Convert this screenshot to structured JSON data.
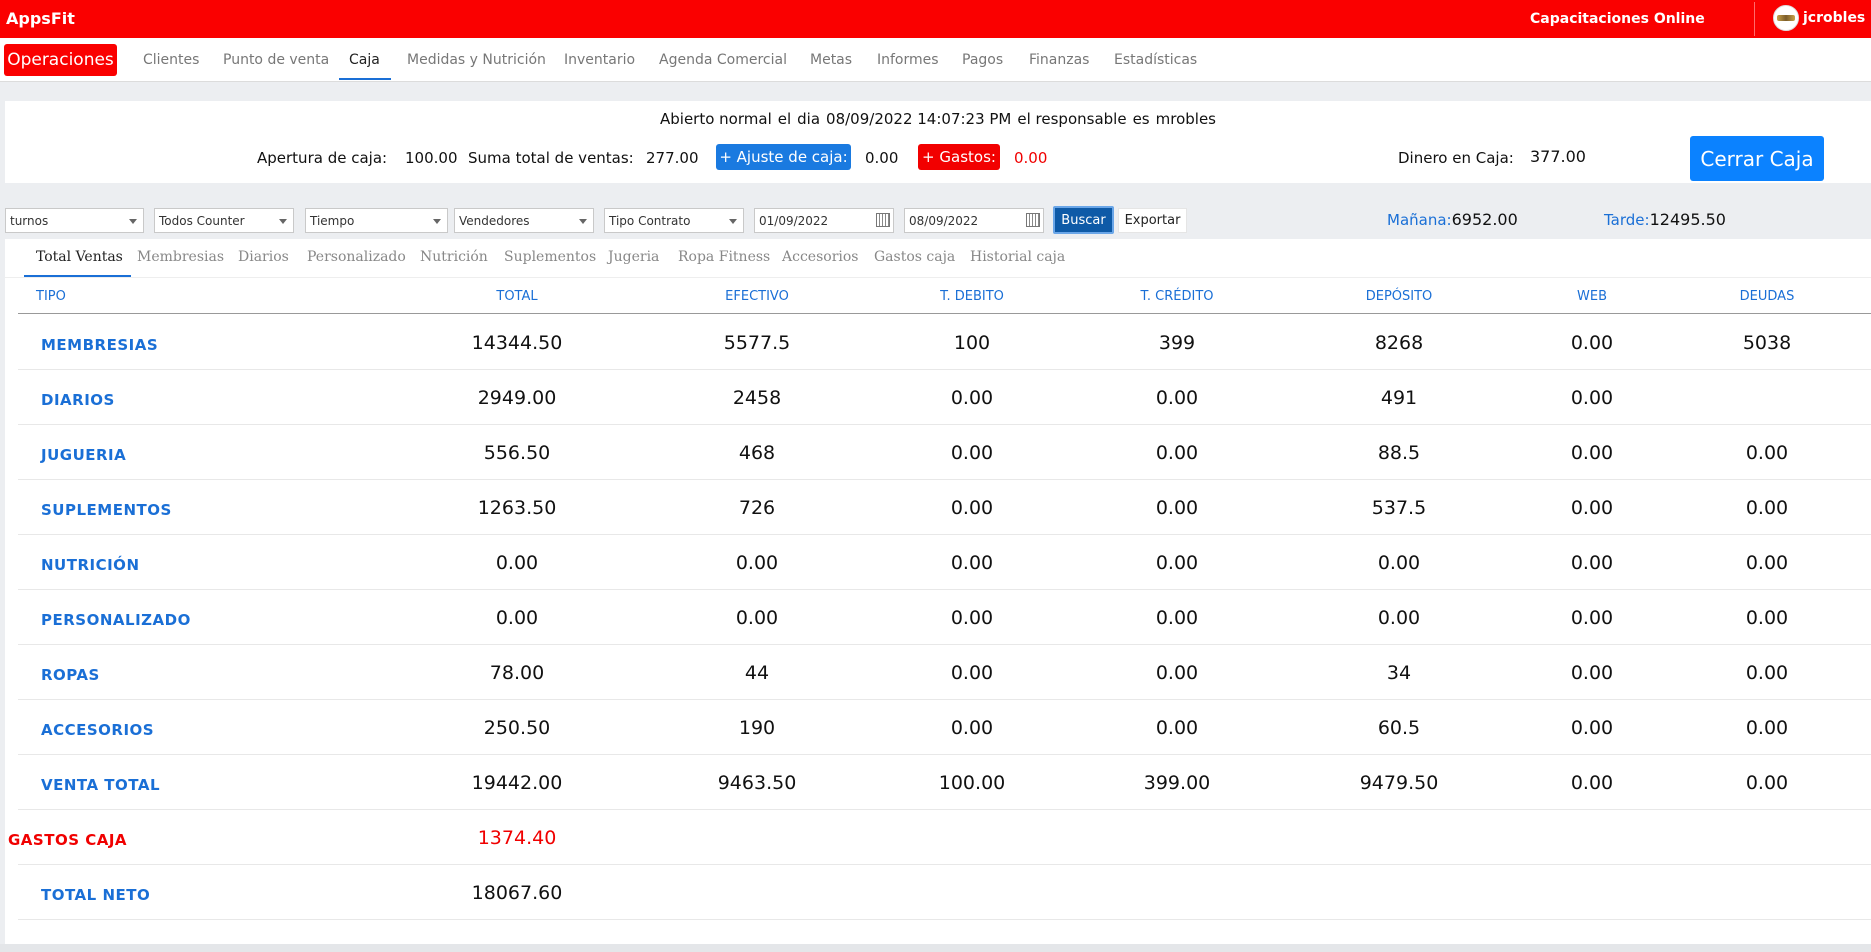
{
  "topbar": {
    "brand": "AppsFit",
    "online": "Capacitaciones Online",
    "user": "jcrobles"
  },
  "nav": {
    "module": "Operaciones",
    "tabs": [
      "Clientes",
      "Punto de venta",
      "Caja",
      "Medidas y Nutrición",
      "Inventario",
      "Agenda Comercial",
      "Metas",
      "Informes",
      "Pagos",
      "Finanzas",
      "Estadísticas"
    ],
    "active": "Caja"
  },
  "summary": {
    "abierto": [
      "Abierto normal",
      "el",
      "dia",
      "08/09/2022 14:07:23 PM",
      "el responsable",
      "es",
      "mrobles"
    ],
    "apertura_label": "Apertura de caja:",
    "apertura_value": "100.00",
    "suma_label": "Suma total de ventas:",
    "suma_value": "277.00",
    "ajuste_label": "+ Ajuste de caja:",
    "ajuste_value": "0.00",
    "gastos_label": "+ Gastos:",
    "gastos_value": "0.00",
    "dinero_label": "Dinero en Caja:",
    "dinero_value": "377.00",
    "cerrar_label": "Cerrar Caja"
  },
  "filters": {
    "turnos": "turnos",
    "counter": "Todos Counter",
    "tiempo": "Tiempo",
    "vendedores": "Vendedores",
    "tipo_contrato": "Tipo Contrato",
    "fecha_desde": "01/09/2022",
    "fecha_hasta": "08/09/2022",
    "buscar": "Buscar",
    "exportar": "Exportar",
    "manana_label": "Mañana:",
    "manana_value": "6952.00",
    "tarde_label": "Tarde:",
    "tarde_value": "12495.50"
  },
  "subtabs": [
    "Total Ventas",
    "Membresias",
    "Diarios",
    "Personalizado",
    "Nutrición",
    "Suplementos",
    "Jugeria",
    "Ropa Fitness",
    "Accesorios",
    "Gastos caja",
    "Historial caja"
  ],
  "table": {
    "headers": [
      "TIPO",
      "TOTAL",
      "EFECTIVO",
      "T. DEBITO",
      "T. CRÉDITO",
      "DEPÓSITO",
      "WEB",
      "DEUDAS"
    ],
    "rows": [
      {
        "tipo": "MEMBRESIAS",
        "vals": [
          "14344.50",
          "5577.5",
          "100",
          "399",
          "8268",
          "0.00",
          "5038"
        ]
      },
      {
        "tipo": "DIARIOS",
        "vals": [
          "2949.00",
          "2458",
          "0.00",
          "0.00",
          "491",
          "0.00",
          ""
        ]
      },
      {
        "tipo": "JUGUERIA",
        "vals": [
          "556.50",
          "468",
          "0.00",
          "0.00",
          "88.5",
          "0.00",
          "0.00"
        ]
      },
      {
        "tipo": "SUPLEMENTOS",
        "vals": [
          "1263.50",
          "726",
          "0.00",
          "0.00",
          "537.5",
          "0.00",
          "0.00"
        ]
      },
      {
        "tipo": "NUTRICIÓN",
        "vals": [
          "0.00",
          "0.00",
          "0.00",
          "0.00",
          "0.00",
          "0.00",
          "0.00"
        ]
      },
      {
        "tipo": "PERSONALIZADO",
        "vals": [
          "0.00",
          "0.00",
          "0.00",
          "0.00",
          "0.00",
          "0.00",
          "0.00"
        ]
      },
      {
        "tipo": "ROPAS",
        "vals": [
          "78.00",
          "44",
          "0.00",
          "0.00",
          "34",
          "0.00",
          "0.00"
        ]
      },
      {
        "tipo": "ACCESORIOS",
        "vals": [
          "250.50",
          "190",
          "0.00",
          "0.00",
          "60.5",
          "0.00",
          "0.00"
        ]
      },
      {
        "tipo": "VENTA TOTAL",
        "vals": [
          "19442.00",
          "9463.50",
          "100.00",
          "399.00",
          "9479.50",
          "0.00",
          "0.00"
        ]
      }
    ],
    "gastos_label": "GASTOS CAJA",
    "gastos_value": "1374.40",
    "neto_label": "TOTAL NETO",
    "neto_value": "18067.60"
  },
  "colors": {
    "brand_red": "#fa0000",
    "accent_blue": "#1a6fd6",
    "button_blue": "#0b82ff"
  }
}
